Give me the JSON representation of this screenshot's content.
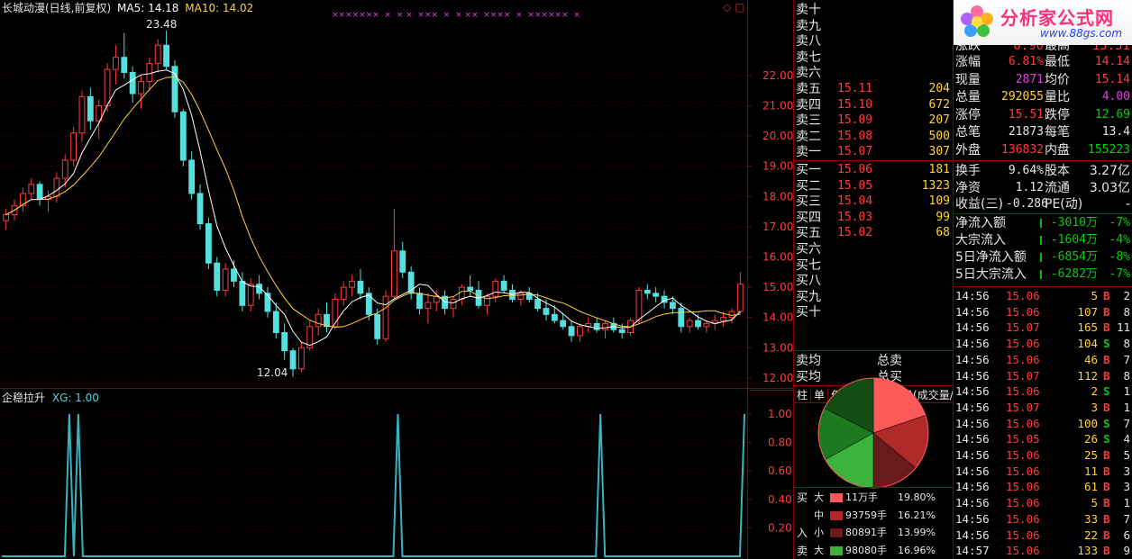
{
  "chart": {
    "title": "长城动漫(日线,前复权)",
    "ma5_label": "MA5: 14.18",
    "ma10_label": "MA10: 14.02",
    "high_label": "23.48",
    "low_label": "12.04",
    "markers": "×××××××  ×  × ×  ×××  ×  × ××  ××××  ×  ××××××  ×",
    "top_icons": "◇ ▢"
  },
  "indicator": {
    "name": "企稳拉升",
    "value_label": "XG: 1.00",
    "axis_labels": [
      "1.00",
      "0.80",
      "0.60",
      "0.40",
      "0.20"
    ]
  },
  "chart_data": [
    {
      "type": "candlestick",
      "y_axis_labels": [
        "22.00",
        "21.00",
        "20.00",
        "19.00",
        "18.00",
        "17.00",
        "16.00",
        "15.00",
        "14.00",
        "13.00",
        "12.00"
      ],
      "ylim": [
        11.7,
        23.9
      ],
      "series_labels": [
        "MA5: 14.18",
        "MA10: 14.02"
      ],
      "candles": [
        [
          17.2,
          17.6,
          16.9,
          17.4
        ],
        [
          17.4,
          17.9,
          17.2,
          17.7
        ],
        [
          17.7,
          18.3,
          17.5,
          18.1
        ],
        [
          18.1,
          18.6,
          17.9,
          18.4
        ],
        [
          18.4,
          18.5,
          17.7,
          17.9
        ],
        [
          17.9,
          18.2,
          17.5,
          18.0
        ],
        [
          18.0,
          18.8,
          17.8,
          18.6
        ],
        [
          18.6,
          19.4,
          18.3,
          19.2
        ],
        [
          19.2,
          20.3,
          19.0,
          20.1
        ],
        [
          20.1,
          21.5,
          19.8,
          21.3
        ],
        [
          21.3,
          21.6,
          20.2,
          20.5
        ],
        [
          20.5,
          21.2,
          19.9,
          21.0
        ],
        [
          21.0,
          22.4,
          20.8,
          22.2
        ],
        [
          22.2,
          23.0,
          21.7,
          22.6
        ],
        [
          22.6,
          23.4,
          21.9,
          22.1
        ],
        [
          22.1,
          22.3,
          21.1,
          21.4
        ],
        [
          21.4,
          22.0,
          20.9,
          21.8
        ],
        [
          21.8,
          22.6,
          21.5,
          22.4
        ],
        [
          22.4,
          23.2,
          22.1,
          23.0
        ],
        [
          23.0,
          23.48,
          22.2,
          22.3
        ],
        [
          22.3,
          22.5,
          20.6,
          20.8
        ],
        [
          20.8,
          20.9,
          19.0,
          19.2
        ],
        [
          19.2,
          19.5,
          17.9,
          18.1
        ],
        [
          18.1,
          18.4,
          16.9,
          17.1
        ],
        [
          17.1,
          17.3,
          15.6,
          15.8
        ],
        [
          15.8,
          16.0,
          14.7,
          14.9
        ],
        [
          14.9,
          15.8,
          14.7,
          15.6
        ],
        [
          15.6,
          15.9,
          15.0,
          15.2
        ],
        [
          15.2,
          15.5,
          14.2,
          14.4
        ],
        [
          14.4,
          15.3,
          14.2,
          15.1
        ],
        [
          15.1,
          15.4,
          14.6,
          14.8
        ],
        [
          14.8,
          15.0,
          14.0,
          14.2
        ],
        [
          14.2,
          14.5,
          13.3,
          13.5
        ],
        [
          13.5,
          13.8,
          12.6,
          12.9
        ],
        [
          12.9,
          13.0,
          12.04,
          12.3
        ],
        [
          12.3,
          13.2,
          12.2,
          13.0
        ],
        [
          13.0,
          13.9,
          12.9,
          13.7
        ],
        [
          13.7,
          14.3,
          13.4,
          14.1
        ],
        [
          14.1,
          14.5,
          13.5,
          13.7
        ],
        [
          13.7,
          14.8,
          13.6,
          14.6
        ],
        [
          14.6,
          15.2,
          14.4,
          15.0
        ],
        [
          15.0,
          15.4,
          14.7,
          15.2
        ],
        [
          15.2,
          15.6,
          14.6,
          14.8
        ],
        [
          14.8,
          15.0,
          13.9,
          14.1
        ],
        [
          14.1,
          14.3,
          13.1,
          13.3
        ],
        [
          13.3,
          14.9,
          13.2,
          14.7
        ],
        [
          14.7,
          17.6,
          14.6,
          16.2
        ],
        [
          16.2,
          16.5,
          15.3,
          15.5
        ],
        [
          15.5,
          15.7,
          14.6,
          14.8
        ],
        [
          14.8,
          15.0,
          14.1,
          14.3
        ],
        [
          14.3,
          14.8,
          13.8,
          14.5
        ],
        [
          14.5,
          14.9,
          14.2,
          14.7
        ],
        [
          14.7,
          14.9,
          14.1,
          14.3
        ],
        [
          14.3,
          14.7,
          14.0,
          14.6
        ],
        [
          14.6,
          15.1,
          14.4,
          15.0
        ],
        [
          15.0,
          15.4,
          14.7,
          14.9
        ],
        [
          14.9,
          15.2,
          14.3,
          14.4
        ],
        [
          14.4,
          14.8,
          14.1,
          14.7
        ],
        [
          14.7,
          15.3,
          14.5,
          15.2
        ],
        [
          15.2,
          15.4,
          14.8,
          14.9
        ],
        [
          14.9,
          15.1,
          14.5,
          14.6
        ],
        [
          14.6,
          14.9,
          14.4,
          14.8
        ],
        [
          14.8,
          15.0,
          14.5,
          14.6
        ],
        [
          14.6,
          14.8,
          14.2,
          14.3
        ],
        [
          14.3,
          14.6,
          13.9,
          14.1
        ],
        [
          14.1,
          14.4,
          13.8,
          13.9
        ],
        [
          13.9,
          14.1,
          13.6,
          13.7
        ],
        [
          13.7,
          13.9,
          13.2,
          13.4
        ],
        [
          13.4,
          13.8,
          13.2,
          13.7
        ],
        [
          13.7,
          14.0,
          13.5,
          13.8
        ],
        [
          13.8,
          14.0,
          13.5,
          13.6
        ],
        [
          13.6,
          13.9,
          13.3,
          13.8
        ],
        [
          13.8,
          14.0,
          13.5,
          13.6
        ],
        [
          13.6,
          13.8,
          13.3,
          13.5
        ],
        [
          13.5,
          14.0,
          13.4,
          13.9
        ],
        [
          13.9,
          15.0,
          13.8,
          14.9
        ],
        [
          14.9,
          15.1,
          14.6,
          14.8
        ],
        [
          14.8,
          15.0,
          14.5,
          14.7
        ],
        [
          14.7,
          14.9,
          14.3,
          14.5
        ],
        [
          14.5,
          14.7,
          14.1,
          14.3
        ],
        [
          14.3,
          14.5,
          13.5,
          13.7
        ],
        [
          13.7,
          14.0,
          13.5,
          13.9
        ],
        [
          13.9,
          14.1,
          13.6,
          13.7
        ],
        [
          13.7,
          13.9,
          13.5,
          13.8
        ],
        [
          13.8,
          14.1,
          13.6,
          13.9
        ],
        [
          13.9,
          14.2,
          13.7,
          14.0
        ],
        [
          14.0,
          14.3,
          13.8,
          14.2
        ],
        [
          14.2,
          15.5,
          14.1,
          15.1
        ]
      ]
    },
    {
      "type": "line",
      "name": "XG",
      "ylim": [
        0,
        1.05
      ],
      "values": [
        0,
        0,
        0,
        0,
        0,
        0,
        0,
        0,
        0,
        0,
        0,
        0,
        0,
        0,
        0,
        1,
        0,
        1,
        0,
        0,
        0,
        0,
        0,
        0,
        0,
        0,
        0,
        0,
        0,
        0,
        0,
        0,
        0,
        0,
        0,
        0,
        0,
        0,
        0,
        0,
        0,
        0,
        0,
        0,
        0,
        0,
        0,
        0,
        0,
        0,
        0,
        0,
        0,
        0,
        0,
        0,
        0,
        0,
        0,
        0,
        0,
        0,
        0,
        0,
        0,
        0,
        0,
        0,
        0,
        0,
        0,
        0,
        0,
        0,
        0,
        0,
        0,
        0,
        0,
        0,
        0,
        0,
        0,
        0,
        0,
        0,
        0,
        0,
        1,
        0,
        0,
        0,
        0,
        0,
        0,
        0,
        0,
        0,
        0,
        0,
        0,
        0,
        0,
        0,
        0,
        0,
        0,
        0,
        0,
        0,
        0,
        0,
        0,
        0,
        0,
        0,
        0,
        0,
        0,
        0,
        0,
        0,
        0,
        0,
        0,
        0,
        0,
        0,
        0,
        0,
        0,
        0,
        0,
        1,
        0,
        0,
        0,
        0,
        0,
        0,
        0,
        0,
        0,
        0,
        0,
        0,
        0,
        0,
        0,
        0,
        0,
        0,
        0,
        0,
        0,
        0,
        0,
        0,
        0,
        0,
        0,
        0,
        0,
        0,
        0,
        1
      ]
    },
    {
      "type": "pie",
      "values": [
        19.8,
        16.21,
        13.99,
        16.96,
        15.5,
        17.54
      ],
      "colors": [
        "#ff5a5a",
        "#b02a2a",
        "#6a1a1a",
        "#3cb33c",
        "#1e7a1e",
        "#134d13"
      ]
    }
  ],
  "orderbook": {
    "sell": [
      {
        "label": "卖十",
        "price": "",
        "vol": ""
      },
      {
        "label": "卖九",
        "price": "",
        "vol": ""
      },
      {
        "label": "卖八",
        "price": "",
        "vol": ""
      },
      {
        "label": "卖七",
        "price": "",
        "vol": ""
      },
      {
        "label": "卖六",
        "price": "",
        "vol": ""
      },
      {
        "label": "卖五",
        "price": "15.11",
        "vol": "204"
      },
      {
        "label": "卖四",
        "price": "15.10",
        "vol": "672"
      },
      {
        "label": "卖三",
        "price": "15.09",
        "vol": "207"
      },
      {
        "label": "卖二",
        "price": "15.08",
        "vol": "500"
      },
      {
        "label": "卖一",
        "price": "15.07",
        "vol": "307"
      }
    ],
    "buy": [
      {
        "label": "买一",
        "price": "15.06",
        "vol": "181"
      },
      {
        "label": "买二",
        "price": "15.05",
        "vol": "1323"
      },
      {
        "label": "买三",
        "price": "15.04",
        "vol": "109"
      },
      {
        "label": "买四",
        "price": "15.03",
        "vol": "99"
      },
      {
        "label": "买五",
        "price": "15.02",
        "vol": "68"
      },
      {
        "label": "买六",
        "price": "",
        "vol": ""
      },
      {
        "label": "买七",
        "price": "",
        "vol": ""
      },
      {
        "label": "买八",
        "price": "",
        "vol": ""
      },
      {
        "label": "买九",
        "price": "",
        "vol": ""
      },
      {
        "label": "买十",
        "price": "",
        "vol": ""
      }
    ],
    "avg_sell": "卖均",
    "avg_buy": "买均",
    "total_sell": "总卖",
    "total_buy": "总买"
  },
  "tabs": [
    "柱",
    "单",
    "仅主动",
    "龙虎看盘(成交量/股"
  ],
  "flow_table": [
    {
      "side": "买",
      "size": "大",
      "vol": "11万手",
      "pct": "19.80%",
      "color": "#ff5a5a"
    },
    {
      "side": "",
      "size": "中",
      "vol": "93759手",
      "pct": "16.21%",
      "color": "#b02a2a"
    },
    {
      "side": "入",
      "size": "小",
      "vol": "80891手",
      "pct": "13.99%",
      "color": "#6a1a1a"
    },
    {
      "side": "卖",
      "size": "大",
      "vol": "98080手",
      "pct": "16.96%",
      "color": "#3cb33c"
    }
  ],
  "logo": {
    "text": "分析家公式网",
    "url": "www.88gs.com"
  },
  "quote": {
    "partial_row": [
      "涨跌",
      "0.90",
      "最高",
      "15.51"
    ],
    "rows": [
      {
        "l1": "涨幅",
        "v1": "6.81%",
        "c1": "#ff3b3b",
        "l2": "最低",
        "v2": "14.14",
        "c2": "#ff3b3b"
      },
      {
        "l1": "现量",
        "v1": "2871",
        "c1": "#e040e0",
        "l2": "均价",
        "v2": "15.14",
        "c2": "#ff3b3b"
      },
      {
        "l1": "总量",
        "v1": "292055",
        "c1": "#ffd23c",
        "l2": "量比",
        "v2": "4.00",
        "c2": "#e040e0"
      },
      {
        "l1": "涨停",
        "v1": "15.51",
        "c1": "#ff3b3b",
        "l2": "跌停",
        "v2": "12.69",
        "c2": "#00d000"
      },
      {
        "l1": "总笔",
        "v1": "21873",
        "c1": "#e6e6e6",
        "l2": "每笔",
        "v2": "13.4",
        "c2": "#e6e6e6"
      },
      {
        "l1": "外盘",
        "v1": "136832",
        "c1": "#ff3b3b",
        "l2": "内盘",
        "v2": "155223",
        "c2": "#00d000"
      }
    ],
    "rows2": [
      {
        "l1": "换手",
        "v1": "9.64%",
        "l2": "股本",
        "v2": "3.27亿"
      },
      {
        "l1": "净资",
        "v1": "1.12",
        "l2": "流通",
        "v2": "3.03亿"
      },
      {
        "l1": "收益(三)",
        "v1": "-0.286",
        "l2": "PE(动)",
        "v2": "-"
      }
    ],
    "flows": [
      {
        "label": "净流入额",
        "val": "-3010万",
        "pct": "-7%"
      },
      {
        "label": "大宗流入",
        "val": "-1604万",
        "pct": "-4%"
      },
      {
        "label": "5日净流入额",
        "val": "-6854万",
        "pct": "-8%"
      },
      {
        "label": "5日大宗流入",
        "val": "-6282万",
        "pct": "-7%"
      }
    ]
  },
  "ticks": [
    {
      "t": "14:56",
      "p": "15.06",
      "v": "5",
      "bs": "B",
      "n": "2"
    },
    {
      "t": "14:56",
      "p": "15.06",
      "v": "107",
      "bs": "B",
      "n": "8"
    },
    {
      "t": "14:56",
      "p": "15.07",
      "v": "165",
      "bs": "B",
      "n": "11"
    },
    {
      "t": "14:56",
      "p": "15.06",
      "v": "104",
      "bs": "S",
      "n": "8"
    },
    {
      "t": "14:56",
      "p": "15.06",
      "v": "46",
      "bs": "B",
      "n": "7"
    },
    {
      "t": "14:56",
      "p": "15.07",
      "v": "112",
      "bs": "B",
      "n": "8"
    },
    {
      "t": "14:56",
      "p": "15.06",
      "v": "2",
      "bs": "S",
      "n": "1"
    },
    {
      "t": "14:56",
      "p": "15.07",
      "v": "3",
      "bs": "B",
      "n": "1"
    },
    {
      "t": "14:56",
      "p": "15.06",
      "v": "100",
      "bs": "S",
      "n": "7"
    },
    {
      "t": "14:56",
      "p": "15.05",
      "v": "26",
      "bs": "S",
      "n": "4"
    },
    {
      "t": "14:56",
      "p": "15.06",
      "v": "25",
      "bs": "B",
      "n": "5"
    },
    {
      "t": "14:56",
      "p": "15.06",
      "v": "11",
      "bs": "B",
      "n": "3"
    },
    {
      "t": "14:56",
      "p": "15.06",
      "v": "61",
      "bs": "B",
      "n": "3"
    },
    {
      "t": "14:56",
      "p": "15.06",
      "v": "5",
      "bs": "B",
      "n": "1"
    },
    {
      "t": "14:56",
      "p": "15.06",
      "v": "33",
      "bs": "B",
      "n": "7"
    },
    {
      "t": "14:56",
      "p": "15.06",
      "v": "22",
      "bs": "B",
      "n": "6"
    },
    {
      "t": "14:57",
      "p": "15.06",
      "v": "133",
      "bs": "B",
      "n": "9"
    }
  ]
}
